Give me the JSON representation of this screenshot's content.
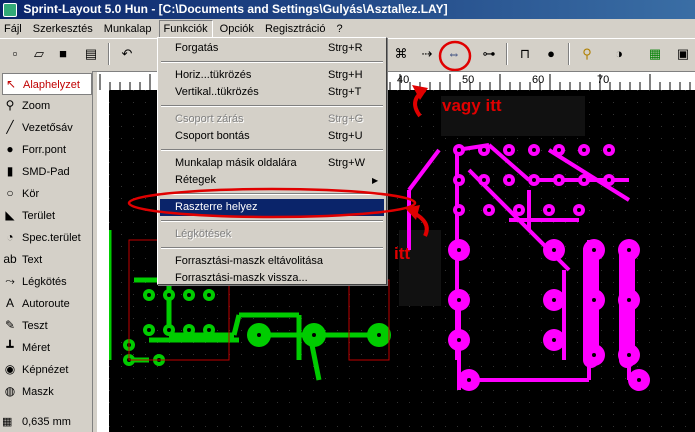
{
  "window": {
    "title": "Sprint-Layout 5.0 Hun   - [C:\\Documents and Settings\\Gulyás\\Asztal\\ez.LAY]"
  },
  "menubar": [
    "Fájl",
    "Szerkesztés",
    "Munkalap",
    "Funkciók",
    "Opciók",
    "Regisztráció",
    "?"
  ],
  "ruler": {
    "ticks": [
      "40",
      "50",
      "60",
      "70"
    ]
  },
  "tools": [
    {
      "label": "Alaphelyzet",
      "icon": "pointer-icon"
    },
    {
      "label": "Zoom",
      "icon": "magnifier-icon"
    },
    {
      "label": "Vezetősáv",
      "icon": "track-icon"
    },
    {
      "label": "Forr.pont",
      "icon": "pad-icon"
    },
    {
      "label": "SMD-Pad",
      "icon": "smd-pad-icon"
    },
    {
      "label": "Kör",
      "icon": "circle-icon"
    },
    {
      "label": "Terület",
      "icon": "area-icon"
    },
    {
      "label": "Spec.terület",
      "icon": "special-area-icon"
    },
    {
      "label": "Text",
      "icon": "text-icon"
    },
    {
      "label": "Légkötés",
      "icon": "airwire-icon"
    },
    {
      "label": "Autoroute",
      "icon": "autoroute-icon"
    },
    {
      "label": "Teszt",
      "icon": "test-icon"
    },
    {
      "label": "Méret",
      "icon": "measure-icon"
    },
    {
      "label": "Képnézet",
      "icon": "photoview-icon"
    },
    {
      "label": "Maszk",
      "icon": "mask-icon"
    }
  ],
  "status": {
    "grid": "0,635 mm"
  },
  "menu": {
    "items": [
      {
        "label": "Forgatás",
        "shortcut": "Strg+R",
        "disabled": false
      },
      {
        "label": "Horiz...tükrözés",
        "shortcut": "Strg+H",
        "disabled": false
      },
      {
        "label": "Vertikal..tükrözés",
        "shortcut": "Strg+T",
        "disabled": false
      },
      {
        "label": "Csoport zárás",
        "shortcut": "Strg+G",
        "disabled": true
      },
      {
        "label": "Csoport bontás",
        "shortcut": "Strg+U",
        "disabled": false
      },
      {
        "label": "Munkalap másik oldalára",
        "shortcut": "Strg+W",
        "disabled": false
      },
      {
        "label": "Rétegek",
        "shortcut": "",
        "disabled": false
      },
      {
        "label": "Raszterre helyez",
        "shortcut": "",
        "disabled": false,
        "highlighted": true
      },
      {
        "label": "Légkötések",
        "shortcut": "",
        "disabled": true
      },
      {
        "label": "Forrasztási-maszk eltávolitása",
        "shortcut": "",
        "disabled": false
      },
      {
        "label": "Forrasztási-maszk vissza...",
        "shortcut": "",
        "disabled": false
      }
    ]
  },
  "annotations": {
    "top": "vagy itt",
    "side": "itt"
  },
  "colors": {
    "top_copper": "#ff00ff",
    "bottom_copper": "#00cc00",
    "annotation": "#e00000",
    "highlight": "#0a246a"
  }
}
